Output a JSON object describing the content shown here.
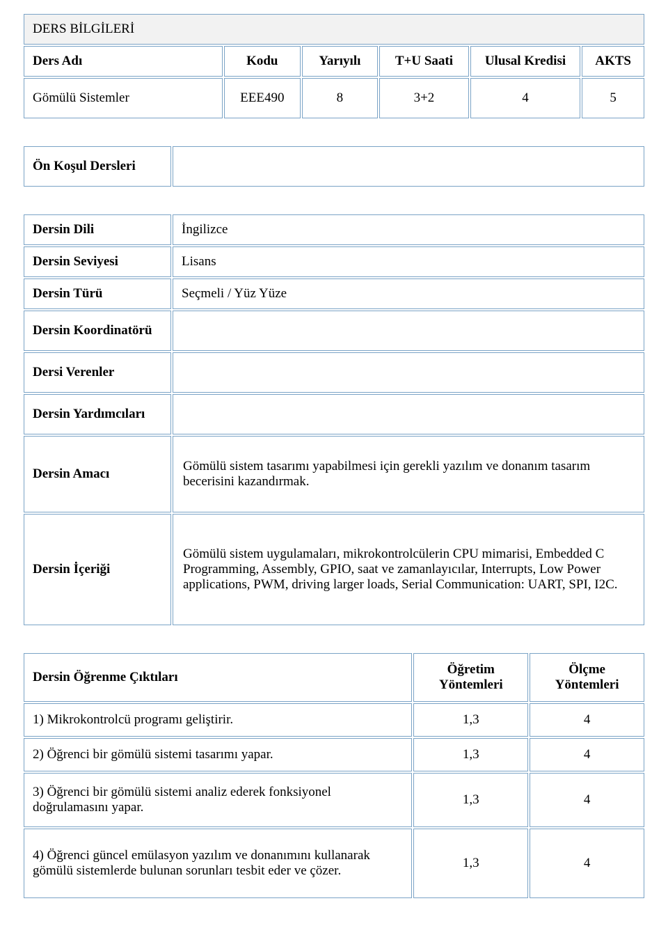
{
  "course_info": {
    "title": "DERS BİLGİLERİ",
    "headers": {
      "name": "Ders Adı",
      "code": "Kodu",
      "semester": "Yarıyılı",
      "hours": "T+U Saati",
      "national_credit": "Ulusal Kredisi",
      "ects": "AKTS"
    },
    "row": {
      "name": "Gömülü Sistemler",
      "code": "EEE490",
      "semester": "8",
      "hours": "3+2",
      "national_credit": "4",
      "ects": "5"
    }
  },
  "prereq": {
    "label": "Ön Koşul Dersleri",
    "value": ""
  },
  "details": {
    "language": {
      "label": "Dersin Dili",
      "value": "İngilizce"
    },
    "level": {
      "label": "Dersin Seviyesi",
      "value": "Lisans"
    },
    "type": {
      "label": "Dersin Türü",
      "value": "Seçmeli / Yüz Yüze"
    },
    "coordinator": {
      "label": "Dersin Koordinatörü",
      "value": ""
    },
    "instructors": {
      "label": "Dersi Verenler",
      "value": ""
    },
    "assistants": {
      "label": "Dersin Yardımcıları",
      "value": ""
    },
    "aim": {
      "label": "Dersin Amacı",
      "value": "Gömülü sistem tasarımı yapabilmesi için gerekli yazılım ve donanım tasarım becerisini kazandırmak."
    },
    "content": {
      "label": "Dersin İçeriği",
      "value": " Gömülü sistem uygulamaları, mikrokontrolcülerin CPU mimarisi, Embedded C Programming, Assembly, GPIO, saat ve zamanlayıcılar, Interrupts, Low Power applications, PWM, driving larger loads, Serial Communication: UART, SPI, I2C."
    }
  },
  "outcomes": {
    "headers": {
      "outcome": "Dersin Öğrenme Çıktıları",
      "teaching": "Öğretim Yöntemleri",
      "assessment": "Ölçme Yöntemleri"
    },
    "rows": [
      {
        "text": "1) Mikrokontrolcü programı geliştirir.",
        "teaching": "1,3",
        "assessment": "4"
      },
      {
        "text": "2) Öğrenci bir gömülü sistemi tasarımı yapar.",
        "teaching": "1,3",
        "assessment": "4"
      },
      {
        "text": "3) Öğrenci bir gömülü sistemi analiz ederek fonksiyonel doğrulamasını yapar.",
        "teaching": "1,3",
        "assessment": "4"
      },
      {
        "text": "4) Öğrenci güncel emülasyon yazılım ve donanımını kullanarak gömülü sistemlerde bulunan sorunları tesbit eder ve çözer.",
        "teaching": "1,3",
        "assessment": "4"
      }
    ]
  }
}
